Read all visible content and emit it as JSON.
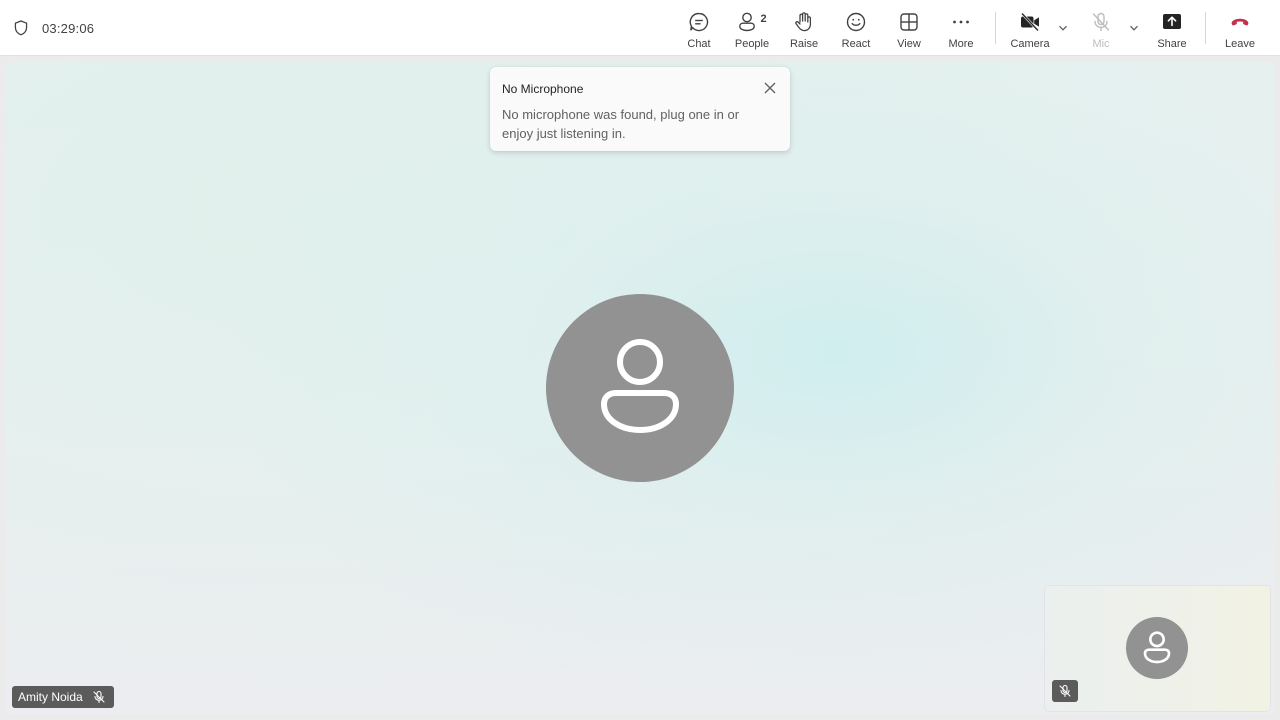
{
  "header": {
    "timer": "03:29:06",
    "controls": {
      "chat": "Chat",
      "people": "People",
      "people_count": "2",
      "raise": "Raise",
      "react": "React",
      "view": "View",
      "more": "More",
      "camera": "Camera",
      "mic": "Mic",
      "share": "Share",
      "leave": "Leave"
    },
    "icons": [
      "shield-icon",
      "chat-icon",
      "people-icon",
      "raise-hand-icon",
      "react-icon",
      "view-icon",
      "more-icon",
      "camera-off-icon",
      "chevron-down-icon",
      "mic-off-icon",
      "share-icon",
      "leave-icon"
    ]
  },
  "toast": {
    "title": "No Microphone",
    "message": "No microphone was found, plug one in or enjoy just listening in."
  },
  "participant": {
    "name": "Amity Noida"
  },
  "colors": {
    "leave_red": "#c4314b",
    "avatar_gray": "#929292",
    "name_tag_bg": "#5b5b5b"
  }
}
